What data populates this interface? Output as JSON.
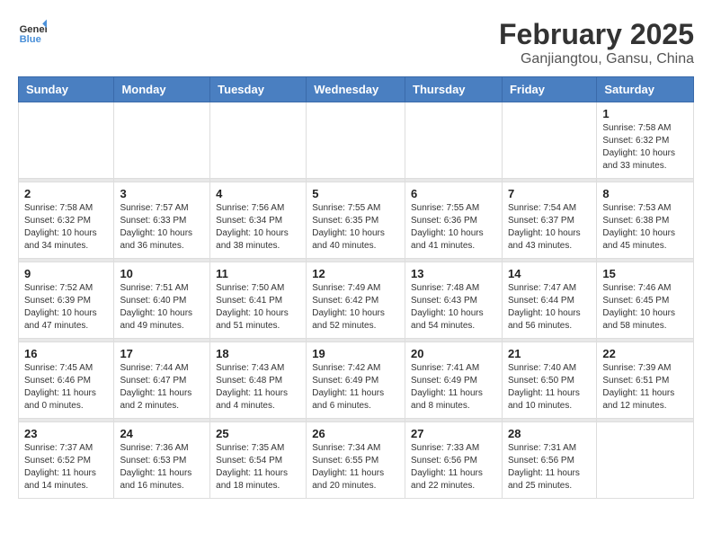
{
  "header": {
    "logo_general": "General",
    "logo_blue": "Blue",
    "title": "February 2025",
    "subtitle": "Ganjiangtou, Gansu, China"
  },
  "weekdays": [
    "Sunday",
    "Monday",
    "Tuesday",
    "Wednesday",
    "Thursday",
    "Friday",
    "Saturday"
  ],
  "weeks": [
    [
      {
        "day": "",
        "info": ""
      },
      {
        "day": "",
        "info": ""
      },
      {
        "day": "",
        "info": ""
      },
      {
        "day": "",
        "info": ""
      },
      {
        "day": "",
        "info": ""
      },
      {
        "day": "",
        "info": ""
      },
      {
        "day": "1",
        "info": "Sunrise: 7:58 AM\nSunset: 6:32 PM\nDaylight: 10 hours and 33 minutes."
      }
    ],
    [
      {
        "day": "2",
        "info": "Sunrise: 7:58 AM\nSunset: 6:32 PM\nDaylight: 10 hours and 34 minutes."
      },
      {
        "day": "3",
        "info": "Sunrise: 7:57 AM\nSunset: 6:33 PM\nDaylight: 10 hours and 36 minutes."
      },
      {
        "day": "4",
        "info": "Sunrise: 7:56 AM\nSunset: 6:34 PM\nDaylight: 10 hours and 38 minutes."
      },
      {
        "day": "5",
        "info": "Sunrise: 7:55 AM\nSunset: 6:35 PM\nDaylight: 10 hours and 40 minutes."
      },
      {
        "day": "6",
        "info": "Sunrise: 7:55 AM\nSunset: 6:36 PM\nDaylight: 10 hours and 41 minutes."
      },
      {
        "day": "7",
        "info": "Sunrise: 7:54 AM\nSunset: 6:37 PM\nDaylight: 10 hours and 43 minutes."
      },
      {
        "day": "8",
        "info": "Sunrise: 7:53 AM\nSunset: 6:38 PM\nDaylight: 10 hours and 45 minutes."
      }
    ],
    [
      {
        "day": "9",
        "info": "Sunrise: 7:52 AM\nSunset: 6:39 PM\nDaylight: 10 hours and 47 minutes."
      },
      {
        "day": "10",
        "info": "Sunrise: 7:51 AM\nSunset: 6:40 PM\nDaylight: 10 hours and 49 minutes."
      },
      {
        "day": "11",
        "info": "Sunrise: 7:50 AM\nSunset: 6:41 PM\nDaylight: 10 hours and 51 minutes."
      },
      {
        "day": "12",
        "info": "Sunrise: 7:49 AM\nSunset: 6:42 PM\nDaylight: 10 hours and 52 minutes."
      },
      {
        "day": "13",
        "info": "Sunrise: 7:48 AM\nSunset: 6:43 PM\nDaylight: 10 hours and 54 minutes."
      },
      {
        "day": "14",
        "info": "Sunrise: 7:47 AM\nSunset: 6:44 PM\nDaylight: 10 hours and 56 minutes."
      },
      {
        "day": "15",
        "info": "Sunrise: 7:46 AM\nSunset: 6:45 PM\nDaylight: 10 hours and 58 minutes."
      }
    ],
    [
      {
        "day": "16",
        "info": "Sunrise: 7:45 AM\nSunset: 6:46 PM\nDaylight: 11 hours and 0 minutes."
      },
      {
        "day": "17",
        "info": "Sunrise: 7:44 AM\nSunset: 6:47 PM\nDaylight: 11 hours and 2 minutes."
      },
      {
        "day": "18",
        "info": "Sunrise: 7:43 AM\nSunset: 6:48 PM\nDaylight: 11 hours and 4 minutes."
      },
      {
        "day": "19",
        "info": "Sunrise: 7:42 AM\nSunset: 6:49 PM\nDaylight: 11 hours and 6 minutes."
      },
      {
        "day": "20",
        "info": "Sunrise: 7:41 AM\nSunset: 6:49 PM\nDaylight: 11 hours and 8 minutes."
      },
      {
        "day": "21",
        "info": "Sunrise: 7:40 AM\nSunset: 6:50 PM\nDaylight: 11 hours and 10 minutes."
      },
      {
        "day": "22",
        "info": "Sunrise: 7:39 AM\nSunset: 6:51 PM\nDaylight: 11 hours and 12 minutes."
      }
    ],
    [
      {
        "day": "23",
        "info": "Sunrise: 7:37 AM\nSunset: 6:52 PM\nDaylight: 11 hours and 14 minutes."
      },
      {
        "day": "24",
        "info": "Sunrise: 7:36 AM\nSunset: 6:53 PM\nDaylight: 11 hours and 16 minutes."
      },
      {
        "day": "25",
        "info": "Sunrise: 7:35 AM\nSunset: 6:54 PM\nDaylight: 11 hours and 18 minutes."
      },
      {
        "day": "26",
        "info": "Sunrise: 7:34 AM\nSunset: 6:55 PM\nDaylight: 11 hours and 20 minutes."
      },
      {
        "day": "27",
        "info": "Sunrise: 7:33 AM\nSunset: 6:56 PM\nDaylight: 11 hours and 22 minutes."
      },
      {
        "day": "28",
        "info": "Sunrise: 7:31 AM\nSunset: 6:56 PM\nDaylight: 11 hours and 25 minutes."
      },
      {
        "day": "",
        "info": ""
      }
    ]
  ]
}
